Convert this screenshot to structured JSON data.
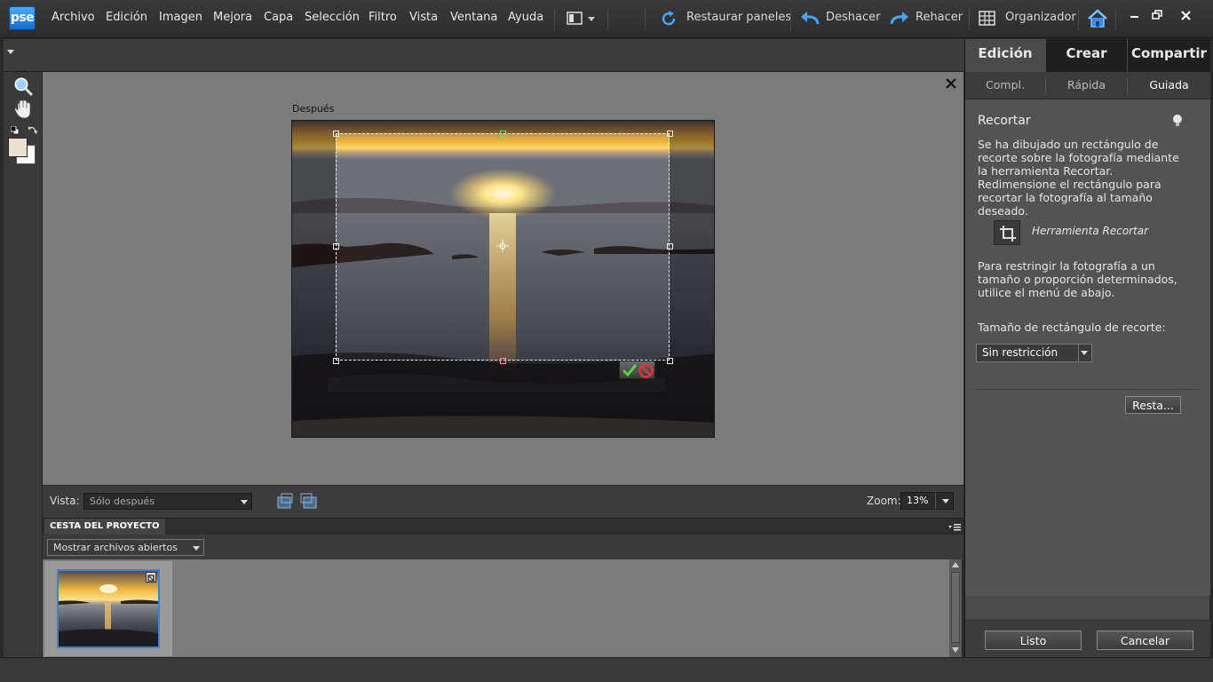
{
  "app": {
    "logo_text": "pse",
    "accent_color": "#2f8eea"
  },
  "menu": {
    "items": [
      "Archivo",
      "Edición",
      "Imagen",
      "Mejora",
      "Capa",
      "Selección",
      "Filtro",
      "Vista",
      "Ventana",
      "Ayuda"
    ]
  },
  "toolbar": {
    "restore_panels": "Restaurar paneles",
    "undo": "Deshacer",
    "redo": "Rehacer",
    "organizer": "Organizador"
  },
  "canvas": {
    "after_label": "Después"
  },
  "viewbar": {
    "view_label": "Vista:",
    "view_value": "Sólo después",
    "zoom_label": "Zoom:",
    "zoom_value": "13%"
  },
  "project_bin": {
    "tab_label": "CESTA DEL PROYECTO",
    "filter_value": "Mostrar archivos abiertos"
  },
  "right_panel": {
    "main_tabs": [
      "Edición",
      "Crear",
      "Compartir"
    ],
    "sub_tabs": [
      "Compl.",
      "Rápida",
      "Guiada"
    ],
    "title": "Recortar",
    "intro": "Se ha dibujado un rectángulo de recorte sobre la fotografía mediante la herramienta Recortar. Redimensione el rectángulo para recortar la fotografía al tamaño deseado.",
    "tool_name": "Herramienta Recortar",
    "restrict_text": "Para restringir la fotografía a un tamaño o proporción determinados, utilice el menú de abajo.",
    "size_label": "Tamaño de rectángulo de recorte:",
    "size_value": "Sin restricción",
    "reset_button": "Resta...",
    "done_button": "Listo",
    "cancel_button": "Cancelar"
  }
}
